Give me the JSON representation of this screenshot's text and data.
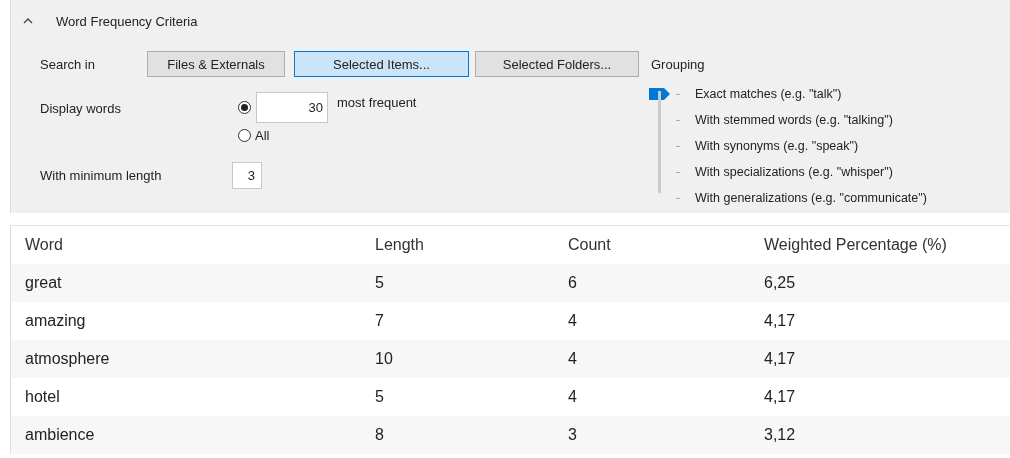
{
  "criteria": {
    "title": "Word Frequency Criteria",
    "expanded": true,
    "search_in": {
      "label": "Search in",
      "buttons": [
        {
          "label": "Files & Externals",
          "selected": false
        },
        {
          "label": "Selected Items...",
          "selected": true
        },
        {
          "label": "Selected Folders...",
          "selected": false
        }
      ]
    },
    "display_words": {
      "label": "Display words",
      "options": [
        {
          "kind": "count",
          "selected": true,
          "value": "30",
          "suffix": "most frequent"
        },
        {
          "kind": "all",
          "selected": false,
          "label": "All"
        }
      ]
    },
    "minimum_length": {
      "label": "With minimum length",
      "value": "3"
    },
    "grouping": {
      "label": "Grouping",
      "options": [
        {
          "label": "Exact matches (e.g. \"talk\")",
          "selected": true
        },
        {
          "label": "With stemmed words (e.g. \"talking\")",
          "selected": false
        },
        {
          "label": "With synonyms (e.g. \"speak\")",
          "selected": false
        },
        {
          "label": "With specializations (e.g. \"whisper\")",
          "selected": false
        },
        {
          "label": "With generalizations (e.g. \"communicate\")",
          "selected": false
        }
      ]
    }
  },
  "table": {
    "columns": [
      "Word",
      "Length",
      "Count",
      "Weighted Percentage (%)"
    ],
    "rows": [
      [
        "great",
        "5",
        "6",
        "6,25"
      ],
      [
        "amazing",
        "7",
        "4",
        "4,17"
      ],
      [
        "atmosphere",
        "10",
        "4",
        "4,17"
      ],
      [
        "hotel",
        "5",
        "4",
        "4,17"
      ],
      [
        "ambience",
        "8",
        "3",
        "3,12"
      ]
    ]
  }
}
